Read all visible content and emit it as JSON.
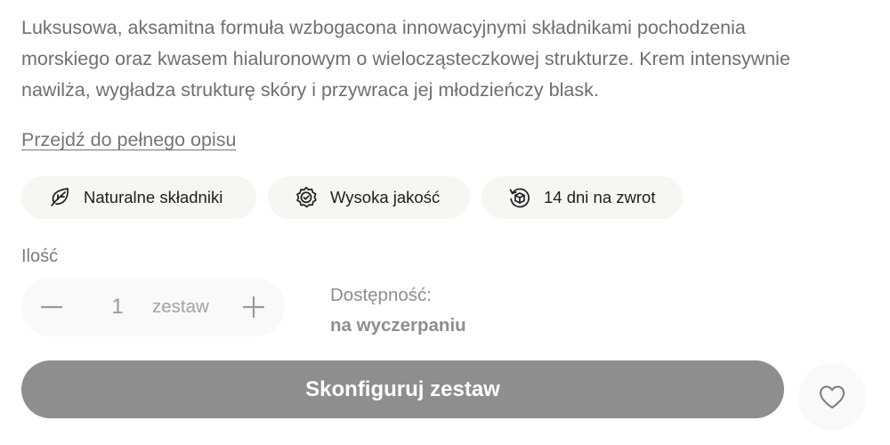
{
  "product": {
    "description_lines": [
      "Luksusowa, aksamitna formuła wzbogacona innowacyjnymi składnikami pochodzenia",
      "morskiego oraz kwasem hialuronowym o wielocząsteczkowej strukturze. Krem intensywnie",
      "nawilża, wygładza strukturę skóry i przywraca jej młodzieńczy blask."
    ],
    "full_description_link": "Przejdź do pełnego opisu"
  },
  "features": [
    {
      "label": "Naturalne składniki",
      "icon": "leaf-icon"
    },
    {
      "label": "Wysoka jakość",
      "icon": "quality-badge-icon"
    },
    {
      "label": "14 dni na zwrot",
      "icon": "return-box-icon"
    }
  ],
  "quantity": {
    "label": "Ilość",
    "value": "1",
    "unit": "zestaw",
    "decrement_icon": "minus-icon",
    "increment_icon": "plus-icon"
  },
  "availability": {
    "label": "Dostępność:",
    "value": "na wyczerpaniu"
  },
  "actions": {
    "configure_label": "Skonfiguruj zestaw",
    "wishlist_icon": "heart-icon"
  },
  "colors": {
    "primary_button": "#8e8e8e",
    "chip_background": "#f6f6f3",
    "text_muted": "#6f6f6f"
  }
}
